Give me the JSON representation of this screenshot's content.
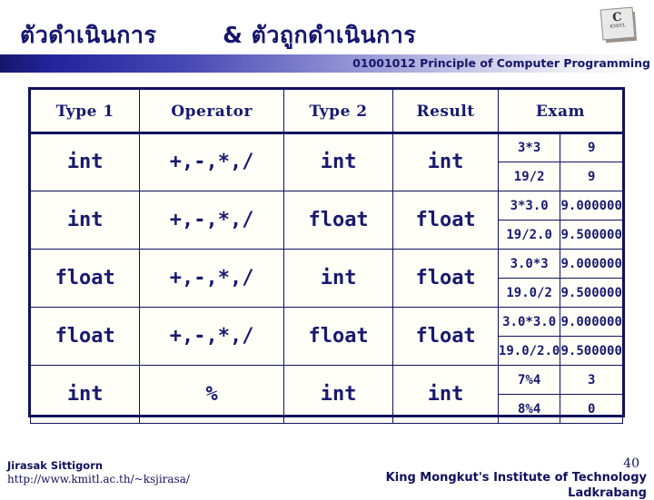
{
  "slide": {
    "title_main": "ตัวดำเนินการ",
    "title_second": "& ตัวถูกดำเนินการ",
    "banner_text": "01001012 Principle of Computer Programming",
    "page_number": "40",
    "accent_color": "#191970",
    "banner_gradient_start": "#16166b",
    "banner_gradient_end": "#ffffff"
  },
  "logo": {
    "mark": "C",
    "sub": "KMITL"
  },
  "table": {
    "headers": {
      "type1": "Type 1",
      "operator": "Operator",
      "type2": "Type 2",
      "result": "Result",
      "exam": "Exam"
    },
    "rows": [
      {
        "type1": "int",
        "operator": "+,-,*,/",
        "type2": "int",
        "result": "int",
        "examples": [
          {
            "expr": "3*3",
            "value": "9"
          },
          {
            "expr": "19/2",
            "value": "9"
          }
        ]
      },
      {
        "type1": "int",
        "operator": "+,-,*,/",
        "type2": "float",
        "result": "float",
        "examples": [
          {
            "expr": "3*3.0",
            "value": "9.000000"
          },
          {
            "expr": "19/2.0",
            "value": "9.500000"
          }
        ]
      },
      {
        "type1": "float",
        "operator": "+,-,*,/",
        "type2": "int",
        "result": "float",
        "examples": [
          {
            "expr": "3.0*3",
            "value": "9.000000"
          },
          {
            "expr": "19.0/2",
            "value": "9.500000"
          }
        ]
      },
      {
        "type1": "float",
        "operator": "+,-,*,/",
        "type2": "float",
        "result": "float",
        "examples": [
          {
            "expr": "3.0*3.0",
            "value": "9.000000"
          },
          {
            "expr": "19.0/2.0",
            "value": "9.500000"
          }
        ]
      },
      {
        "type1": "int",
        "operator": "%",
        "type2": "int",
        "result": "int",
        "examples": [
          {
            "expr": "7%4",
            "value": "3"
          },
          {
            "expr": "8%4",
            "value": "0"
          }
        ]
      }
    ]
  },
  "footer": {
    "author": "Jirasak Sittigorn",
    "url": "http://www.kmitl.ac.th/~ksjirasa/",
    "institute_line1": "King Mongkut's Institute of Technology",
    "institute_line2": "Ladkrabang"
  }
}
